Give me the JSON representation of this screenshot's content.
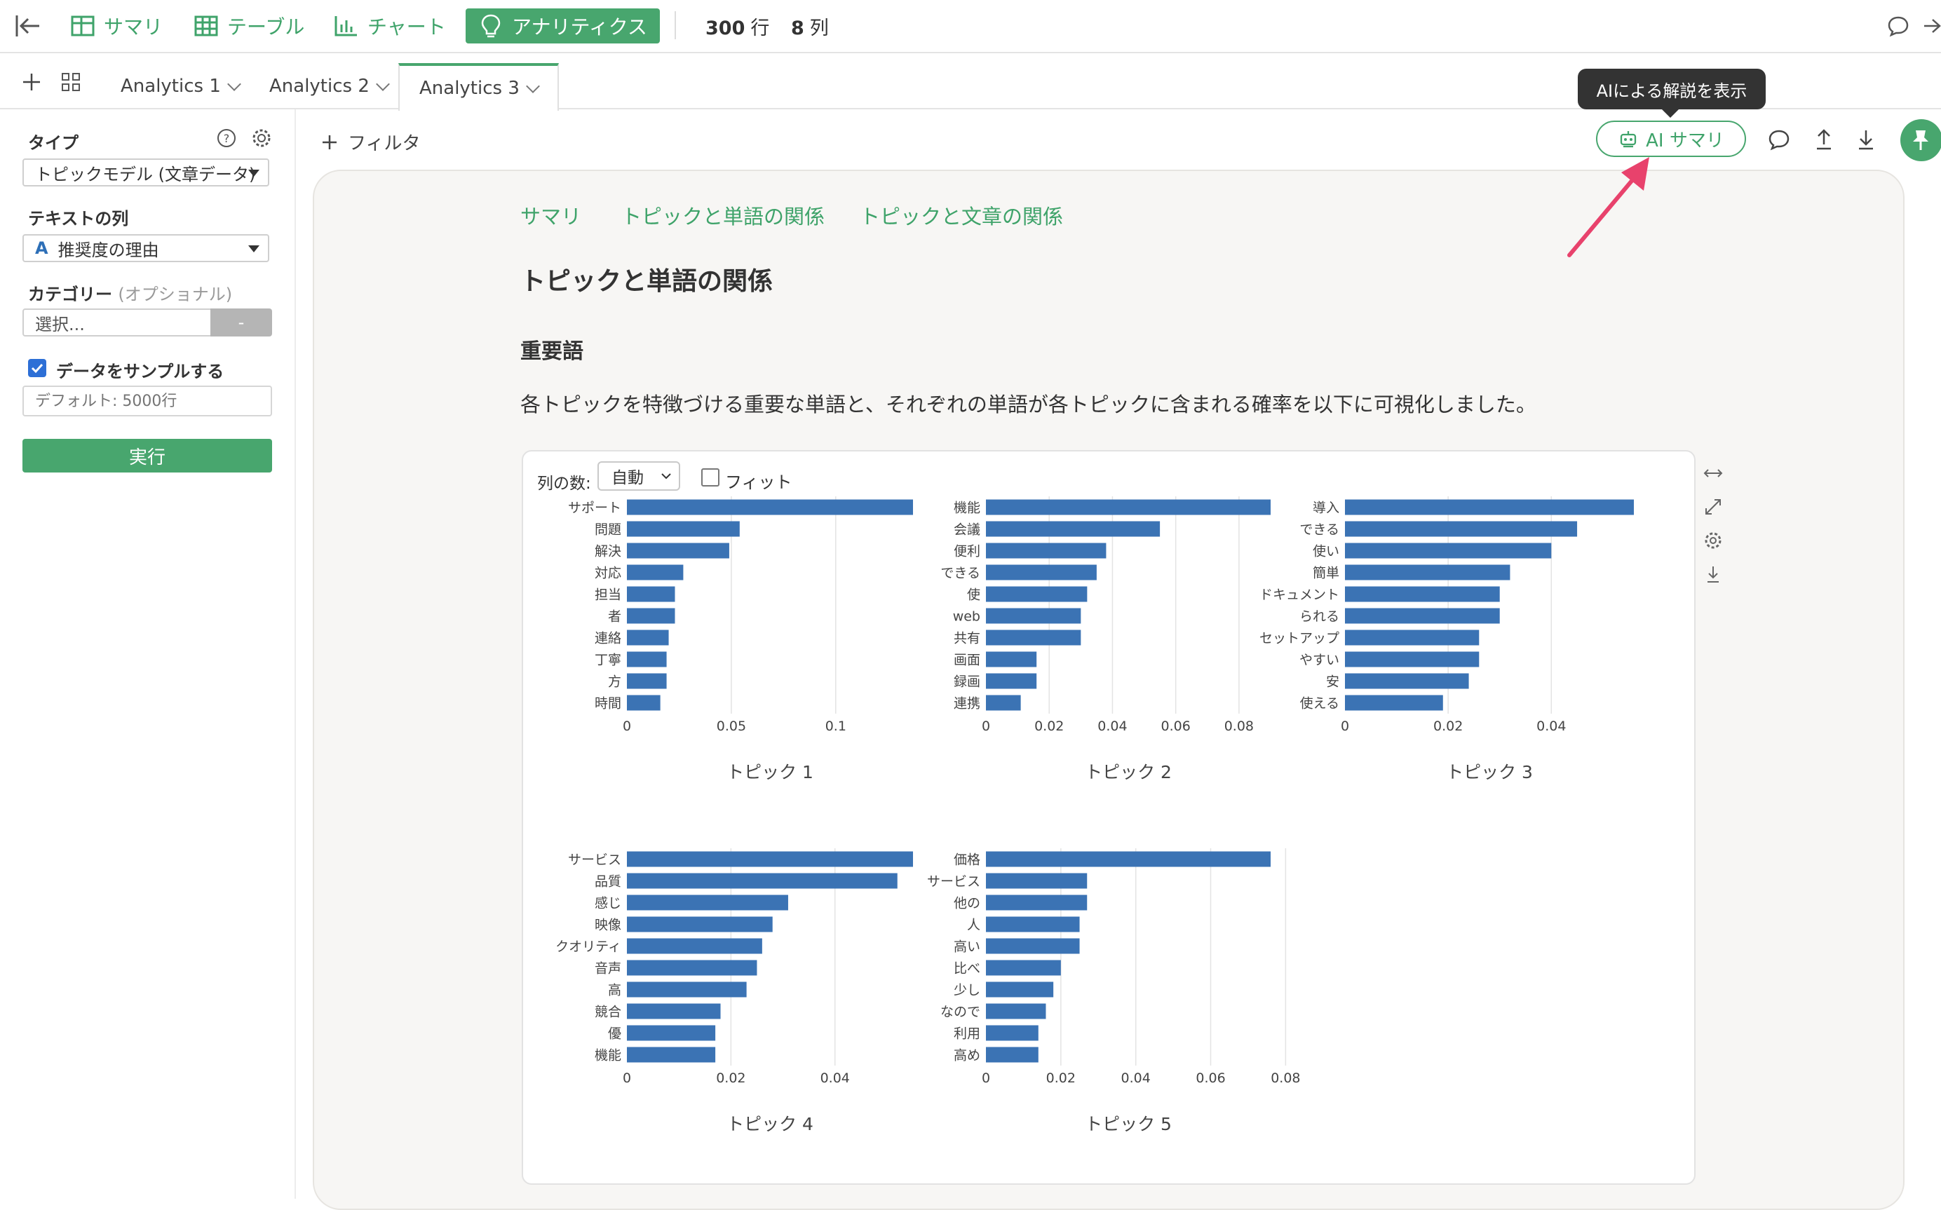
{
  "topbar": {
    "nav": [
      {
        "label": "サマリ",
        "icon": "table-icon"
      },
      {
        "label": "テーブル",
        "icon": "table-icon"
      },
      {
        "label": "チャート",
        "icon": "chart-icon"
      },
      {
        "label": "アナリティクス",
        "icon": "bulb-icon",
        "active": true
      }
    ],
    "rows": "300",
    "rows_unit": "行",
    "cols": "8",
    "cols_unit": "列"
  },
  "tabs": [
    {
      "label": "Analytics 1"
    },
    {
      "label": "Analytics 2"
    },
    {
      "label": "Analytics 3",
      "active": true
    }
  ],
  "sidebar": {
    "type_label": "タイプ",
    "type_value": "トピックモデル (文章データ)",
    "text_col_label": "テキストの列",
    "text_col_value": "推奨度の理由",
    "text_col_icon": "A",
    "category_label": "カテゴリー",
    "category_optional": "(オプショナル)",
    "category_value": "選択...",
    "category_btn": "-",
    "sample_label": "データをサンプルする",
    "sample_checked": true,
    "sample_placeholder": "デフォルト: 5000行",
    "run_label": "実行"
  },
  "toolbar": {
    "filter_label": "フィルタ",
    "ai_button_label": "AI サマリ",
    "tooltip": "AIによる解説を表示"
  },
  "content": {
    "subtabs": [
      "サマリ",
      "トピックと単語の関係",
      "トピックと文章の関係"
    ],
    "title": "トピックと単語の関係",
    "subtitle": "重要語",
    "description": "各トピックを特徴づける重要な単語と、それぞれの単語が各トピックに含まれる確率を以下に可視化しました。",
    "cols_label": "列の数:",
    "cols_value": "自動",
    "fit_label": "フィット"
  },
  "colors": {
    "accent": "#48a66e",
    "bar": "#3b73b4",
    "arrow": "#e8426c"
  },
  "chart_data": [
    {
      "type": "bar",
      "orientation": "horizontal",
      "title": "トピック 1",
      "categories": [
        "サポート",
        "問題",
        "解決",
        "対応",
        "担当",
        "者",
        "連絡",
        "丁寧",
        "方",
        "時間"
      ],
      "values": [
        0.137,
        0.054,
        0.049,
        0.027,
        0.023,
        0.023,
        0.02,
        0.019,
        0.019,
        0.016
      ],
      "xticks": [
        0,
        0.05,
        0.1
      ],
      "xtick_labels": [
        "0",
        "0.05",
        "0.1"
      ],
      "xlim": [
        0,
        0.137
      ]
    },
    {
      "type": "bar",
      "orientation": "horizontal",
      "title": "トピック 2",
      "categories": [
        "機能",
        "会議",
        "便利",
        "できる",
        "使",
        "web",
        "共有",
        "画面",
        "録画",
        "連携"
      ],
      "values": [
        0.09,
        0.055,
        0.038,
        0.035,
        0.032,
        0.03,
        0.03,
        0.016,
        0.016,
        0.011
      ],
      "xticks": [
        0,
        0.02,
        0.04,
        0.06,
        0.08
      ],
      "xtick_labels": [
        "0",
        "0.02",
        "0.04",
        "0.06",
        "0.08"
      ],
      "xlim": [
        0,
        0.09
      ]
    },
    {
      "type": "bar",
      "orientation": "horizontal",
      "title": "トピック 3",
      "categories": [
        "導入",
        "できる",
        "使い",
        "簡単",
        "ドキュメント",
        "られる",
        "セットアップ",
        "やすい",
        "安",
        "使える"
      ],
      "values": [
        0.056,
        0.045,
        0.04,
        0.032,
        0.03,
        0.03,
        0.026,
        0.026,
        0.024,
        0.019
      ],
      "xticks": [
        0,
        0.02,
        0.04
      ],
      "xtick_labels": [
        "0",
        "0.02",
        "0.04"
      ],
      "xlim": [
        0,
        0.056
      ]
    },
    {
      "type": "bar",
      "orientation": "horizontal",
      "title": "トピック 4",
      "categories": [
        "サービス",
        "品質",
        "感じ",
        "映像",
        "クオリティ",
        "音声",
        "高",
        "競合",
        "優",
        "機能"
      ],
      "values": [
        0.055,
        0.052,
        0.031,
        0.028,
        0.026,
        0.025,
        0.023,
        0.018,
        0.017,
        0.017
      ],
      "xticks": [
        0,
        0.02,
        0.04
      ],
      "xtick_labels": [
        "0",
        "0.02",
        "0.04"
      ],
      "xlim": [
        0,
        0.055
      ]
    },
    {
      "type": "bar",
      "orientation": "horizontal",
      "title": "トピック 5",
      "categories": [
        "価格",
        "サービス",
        "他の",
        "人",
        "高い",
        "比べ",
        "少し",
        "なので",
        "利用",
        "高め"
      ],
      "values": [
        0.076,
        0.027,
        0.027,
        0.025,
        0.025,
        0.02,
        0.018,
        0.016,
        0.014,
        0.014
      ],
      "xticks": [
        0,
        0.02,
        0.04,
        0.06,
        0.08
      ],
      "xtick_labels": [
        "0",
        "0.02",
        "0.04",
        "0.06",
        "0.08"
      ],
      "xlim": [
        0,
        0.076
      ]
    }
  ]
}
